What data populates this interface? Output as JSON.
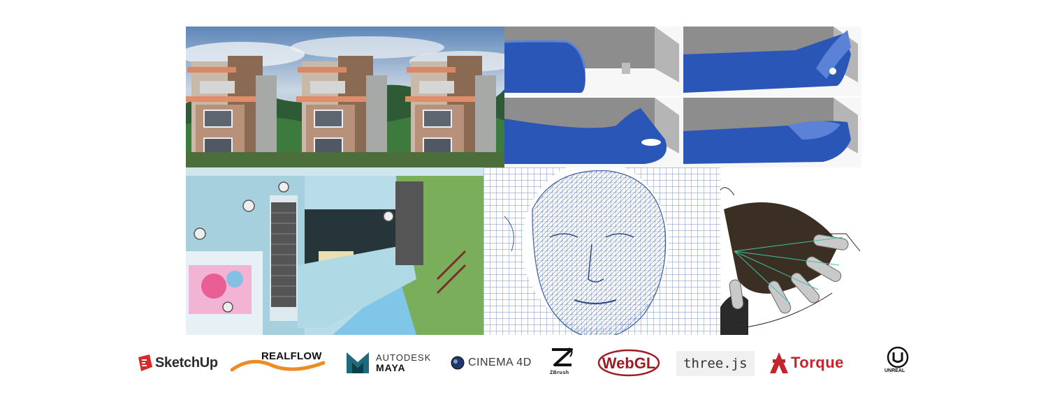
{
  "panels": [
    {
      "name": "buildings-render",
      "subject": "architectural house render"
    },
    {
      "name": "fluid-simulation",
      "subject": "fluid dam-break simulation"
    },
    {
      "name": "stage-render",
      "subject": "concert stage 3D scene"
    },
    {
      "name": "face-wireframe",
      "subject": "wireframe head model"
    },
    {
      "name": "hand-rig",
      "subject": "rigged hand model"
    }
  ],
  "logos": {
    "sketchup": "SketchUp",
    "realflow": "REALFLOW",
    "maya_top": "AUTODESK",
    "maya_bottom": "MAYA",
    "cinema4d": "CINEMA 4D",
    "zbrush": "ZBrush",
    "webgl": "WebGL",
    "threejs": "three.js",
    "torque": "Torque",
    "unreal": "UNREAL"
  },
  "colors": {
    "sketchup": "#d72b2b",
    "realflow": "#f08a24",
    "webgl": "#9c1d23",
    "torque": "#c0272d",
    "fluid": "#2a56b8"
  },
  "icons": [
    "sketchup-icon",
    "realflow-wave-icon",
    "maya-icon",
    "cinema4d-icon",
    "zbrush-icon",
    "unreal-icon",
    "torque-icon"
  ]
}
